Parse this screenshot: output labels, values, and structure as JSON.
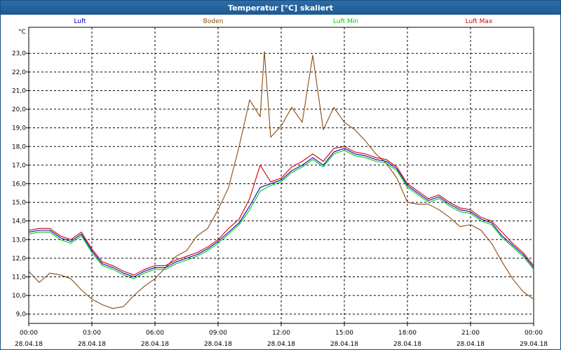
{
  "window": {
    "title": "Temperatur [°C] skaliert"
  },
  "chart_data": {
    "type": "line",
    "title": "Temperatur [°C] skaliert",
    "ylabel": "°C",
    "xlabel": "",
    "ylim": [
      8.5,
      24.4
    ],
    "xlim": [
      0,
      24
    ],
    "yticks": [
      9.0,
      10.0,
      11.0,
      12.0,
      13.0,
      14.0,
      15.0,
      16.0,
      17.0,
      18.0,
      19.0,
      20.0,
      21.0,
      22.0,
      23.0
    ],
    "ytick_labels": [
      "9,0",
      "10,0",
      "11,0",
      "12,0",
      "13,0",
      "14,0",
      "15,0",
      "16,0",
      "17,0",
      "18,0",
      "19,0",
      "20,0",
      "21,0",
      "22,0",
      "23,0"
    ],
    "xticks": [
      0,
      3,
      6,
      9,
      12,
      15,
      18,
      21,
      24
    ],
    "xtick_times": [
      "00:00",
      "03:00",
      "06:00",
      "09:00",
      "12:00",
      "15:00",
      "18:00",
      "21:00",
      "00:00"
    ],
    "xtick_dates": [
      "28.04.18",
      "28.04.18",
      "28.04.18",
      "28.04.18",
      "28.04.18",
      "28.04.18",
      "28.04.18",
      "28.04.18",
      "29.04.18"
    ],
    "grid": true,
    "legend_position": "top",
    "series": [
      {
        "name": "Luft",
        "color": "#0000cc",
        "x": [
          0,
          0.5,
          1,
          1.5,
          2,
          2.5,
          3,
          3.5,
          4,
          4.5,
          5,
          5.5,
          6,
          6.5,
          7,
          7.5,
          8,
          8.5,
          9,
          9.5,
          10,
          10.5,
          11,
          11.5,
          12,
          12.5,
          13,
          13.5,
          14,
          14.5,
          15,
          15.5,
          16,
          16.5,
          17,
          17.5,
          18,
          18.5,
          19,
          19.5,
          20,
          20.5,
          21,
          21.5,
          22,
          22.5,
          23,
          23.5,
          24
        ],
        "values": [
          13.4,
          13.5,
          13.5,
          13.1,
          12.9,
          13.3,
          12.4,
          11.7,
          11.5,
          11.2,
          11.0,
          11.3,
          11.5,
          11.5,
          11.8,
          12.0,
          12.2,
          12.5,
          12.9,
          13.4,
          13.9,
          14.8,
          15.8,
          16.0,
          16.2,
          16.7,
          17.0,
          17.4,
          17.0,
          17.7,
          17.9,
          17.6,
          17.5,
          17.3,
          17.2,
          16.8,
          15.9,
          15.5,
          15.1,
          15.3,
          14.9,
          14.6,
          14.5,
          14.1,
          13.9,
          13.2,
          12.7,
          12.2,
          11.5
        ]
      },
      {
        "name": "Boden",
        "color": "#8b4a0f",
        "x": [
          0,
          0.5,
          1,
          1.5,
          2,
          2.5,
          3,
          3.5,
          4,
          4.5,
          5,
          5.5,
          6,
          6.5,
          7,
          7.5,
          8,
          8.5,
          9,
          9.5,
          10,
          10.5,
          11,
          11.2,
          11.5,
          12,
          12.5,
          13,
          13.5,
          14,
          14.5,
          15,
          15.5,
          16,
          16.5,
          17,
          17.5,
          18,
          18.5,
          19,
          19.5,
          20,
          20.5,
          21,
          21.5,
          22,
          22.5,
          23,
          23.5,
          24
        ],
        "values": [
          11.3,
          10.7,
          11.2,
          11.1,
          10.9,
          10.3,
          9.8,
          9.5,
          9.3,
          9.4,
          10.0,
          10.5,
          10.9,
          11.5,
          12.1,
          12.4,
          13.2,
          13.6,
          14.6,
          15.8,
          18.0,
          20.5,
          19.6,
          23.1,
          18.5,
          19.1,
          20.1,
          19.3,
          22.9,
          18.9,
          20.1,
          19.3,
          18.9,
          18.3,
          17.6,
          17.1,
          16.3,
          15.0,
          14.9,
          14.9,
          14.6,
          14.2,
          13.7,
          13.8,
          13.5,
          12.8,
          11.8,
          10.9,
          10.2,
          9.8
        ]
      },
      {
        "name": "Luft Min",
        "color": "#00cc00",
        "x": [
          0,
          0.5,
          1,
          1.5,
          2,
          2.5,
          3,
          3.5,
          4,
          4.5,
          5,
          5.5,
          6,
          6.5,
          7,
          7.5,
          8,
          8.5,
          9,
          9.5,
          10,
          10.5,
          11,
          11.5,
          12,
          12.5,
          13,
          13.5,
          14,
          14.5,
          15,
          15.5,
          16,
          16.5,
          17,
          17.5,
          18,
          18.5,
          19,
          19.5,
          20,
          20.5,
          21,
          21.5,
          22,
          22.5,
          23,
          23.5,
          24
        ],
        "values": [
          13.3,
          13.4,
          13.4,
          13.0,
          12.8,
          13.2,
          12.3,
          11.6,
          11.4,
          11.1,
          10.9,
          11.2,
          11.4,
          11.4,
          11.7,
          11.9,
          12.1,
          12.4,
          12.8,
          13.3,
          13.8,
          14.6,
          15.6,
          15.9,
          16.1,
          16.6,
          16.9,
          17.3,
          16.9,
          17.6,
          17.8,
          17.5,
          17.4,
          17.2,
          17.1,
          16.7,
          15.8,
          15.4,
          15.0,
          15.2,
          14.8,
          14.5,
          14.4,
          14.0,
          13.8,
          13.1,
          12.6,
          12.1,
          11.4
        ]
      },
      {
        "name": "Luft Max",
        "color": "#cc0000",
        "x": [
          0,
          0.5,
          1,
          1.5,
          2,
          2.5,
          3,
          3.5,
          4,
          4.5,
          5,
          5.5,
          6,
          6.5,
          7,
          7.5,
          8,
          8.5,
          9,
          9.5,
          10,
          10.5,
          11,
          11.5,
          12,
          12.5,
          13,
          13.5,
          14,
          14.5,
          15,
          15.5,
          16,
          16.5,
          17,
          17.5,
          18,
          18.5,
          19,
          19.5,
          20,
          20.5,
          21,
          21.5,
          22,
          22.5,
          23,
          23.5,
          24
        ],
        "values": [
          13.5,
          13.6,
          13.6,
          13.2,
          13.0,
          13.4,
          12.5,
          11.8,
          11.6,
          11.3,
          11.1,
          11.4,
          11.6,
          11.6,
          11.9,
          12.1,
          12.3,
          12.6,
          13.0,
          13.6,
          14.1,
          15.2,
          17.0,
          16.1,
          16.3,
          16.9,
          17.2,
          17.6,
          17.2,
          17.9,
          18.0,
          17.7,
          17.6,
          17.4,
          17.3,
          16.9,
          16.0,
          15.6,
          15.2,
          15.4,
          15.0,
          14.7,
          14.6,
          14.2,
          14.0,
          13.4,
          12.8,
          12.3,
          11.6
        ]
      }
    ]
  }
}
